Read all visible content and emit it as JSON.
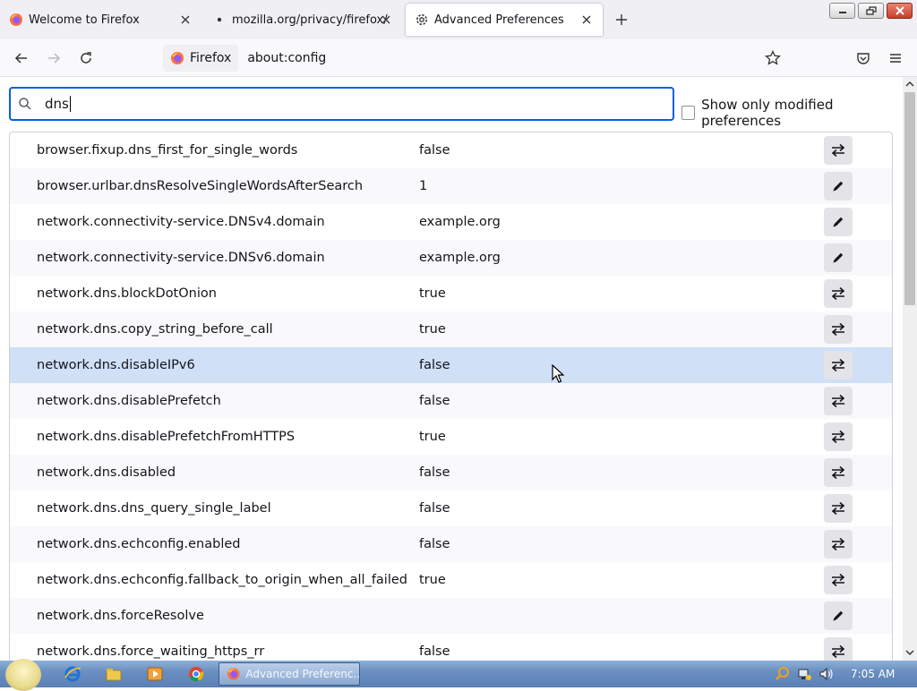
{
  "tabs": [
    {
      "label": "Welcome to Firefox",
      "icon": "firefox-icon"
    },
    {
      "label": "mozilla.org/privacy/firefox/",
      "icon": "dot-icon"
    },
    {
      "label": "Advanced Preferences",
      "icon": "gear-icon",
      "active": true
    }
  ],
  "nav": {
    "identity_label": "Firefox",
    "url": "about:config"
  },
  "search": {
    "value": "dns"
  },
  "modified_filter": {
    "label": "Show only modified preferences",
    "checked": false
  },
  "preferences": [
    {
      "name": "browser.fixup.dns_first_for_single_words",
      "value": "false",
      "action": "toggle"
    },
    {
      "name": "browser.urlbar.dnsResolveSingleWordsAfterSearch",
      "value": "1",
      "action": "edit"
    },
    {
      "name": "network.connectivity-service.DNSv4.domain",
      "value": "example.org",
      "action": "edit"
    },
    {
      "name": "network.connectivity-service.DNSv6.domain",
      "value": "example.org",
      "action": "edit"
    },
    {
      "name": "network.dns.blockDotOnion",
      "value": "true",
      "action": "toggle"
    },
    {
      "name": "network.dns.copy_string_before_call",
      "value": "true",
      "action": "toggle"
    },
    {
      "name": "network.dns.disableIPv6",
      "value": "false",
      "action": "toggle",
      "selected": true
    },
    {
      "name": "network.dns.disablePrefetch",
      "value": "false",
      "action": "toggle"
    },
    {
      "name": "network.dns.disablePrefetchFromHTTPS",
      "value": "true",
      "action": "toggle"
    },
    {
      "name": "network.dns.disabled",
      "value": "false",
      "action": "toggle"
    },
    {
      "name": "network.dns.dns_query_single_label",
      "value": "false",
      "action": "toggle"
    },
    {
      "name": "network.dns.echconfig.enabled",
      "value": "false",
      "action": "toggle"
    },
    {
      "name": "network.dns.echconfig.fallback_to_origin_when_all_failed",
      "value": "true",
      "action": "toggle"
    },
    {
      "name": "network.dns.forceResolve",
      "value": "",
      "action": "edit"
    },
    {
      "name": "network.dns.force_waiting_https_rr",
      "value": "false",
      "action": "toggle"
    }
  ],
  "taskbar": {
    "task_label": "Advanced Preferenc...",
    "clock": "7:05 AM"
  },
  "colors": {
    "accent": "#0061e0",
    "selected_row": "#cfe0f7"
  }
}
